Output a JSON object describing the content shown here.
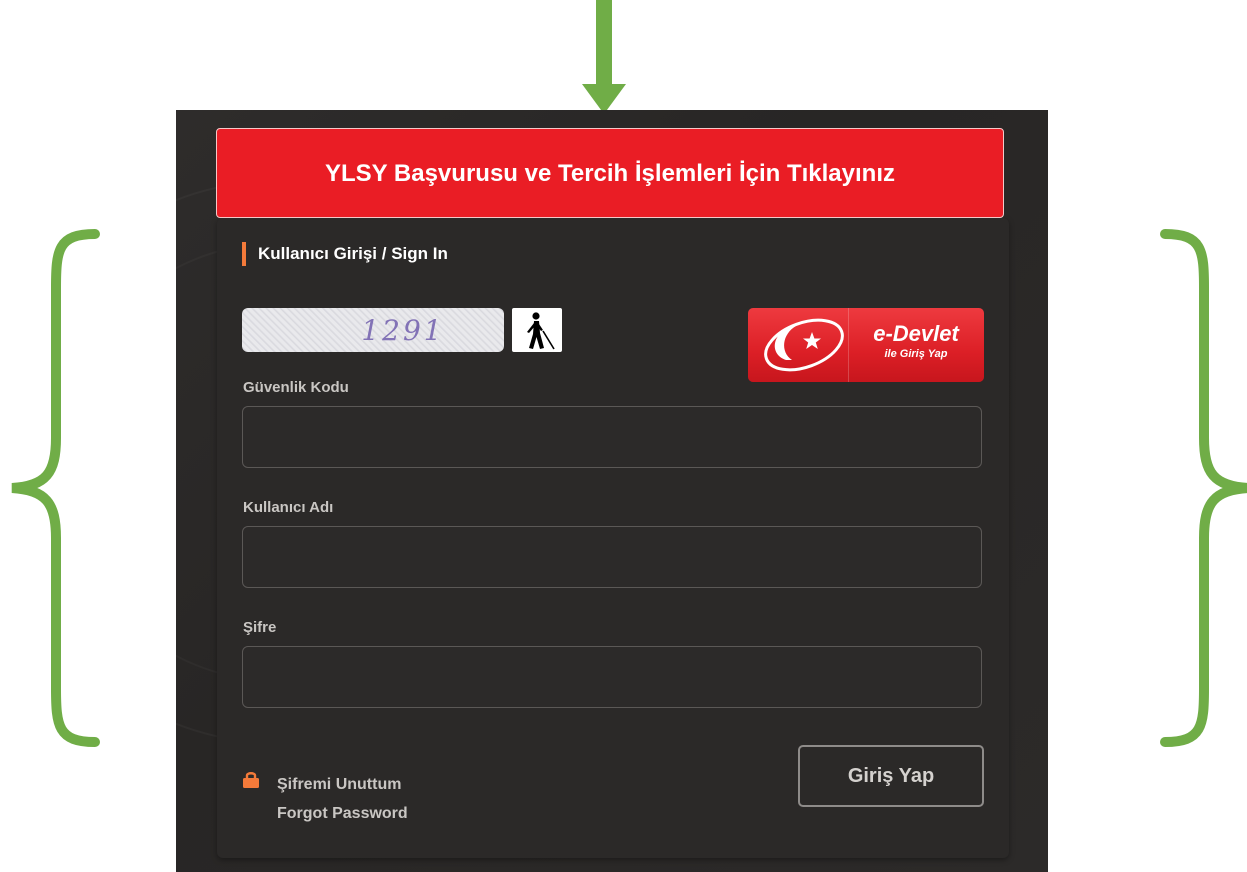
{
  "banner": {
    "text": "YLSY Başvurusu ve Tercih İşlemleri İçin Tıklayınız"
  },
  "login": {
    "section_title": "Kullanıcı Girişi / Sign In",
    "captcha_text": "1291",
    "edevlet": {
      "title": "e-Devlet",
      "subtitle": "ile Giriş Yap"
    },
    "security_code_label": "Güvenlik Kodu",
    "username_label": "Kullanıcı Adı",
    "password_label": "Şifre",
    "security_code_value": "",
    "username_value": "",
    "password_value": "",
    "forgot_tr": "Şifremi Unuttum",
    "forgot_en": "Forgot Password",
    "submit_label": "Giriş Yap"
  },
  "icons": {
    "audio": "accessibility-audio-icon",
    "lock": "lock-icon",
    "arrow": "down-arrow-icon",
    "brace_left": "left-brace-icon",
    "brace_right": "right-brace-icon"
  },
  "colors": {
    "banner_red": "#ea1d25",
    "accent_orange": "#f47a3a",
    "panel_dark": "#2b2928",
    "annotation_green": "#70ad47",
    "edevlet_red": "#dc1f26"
  }
}
